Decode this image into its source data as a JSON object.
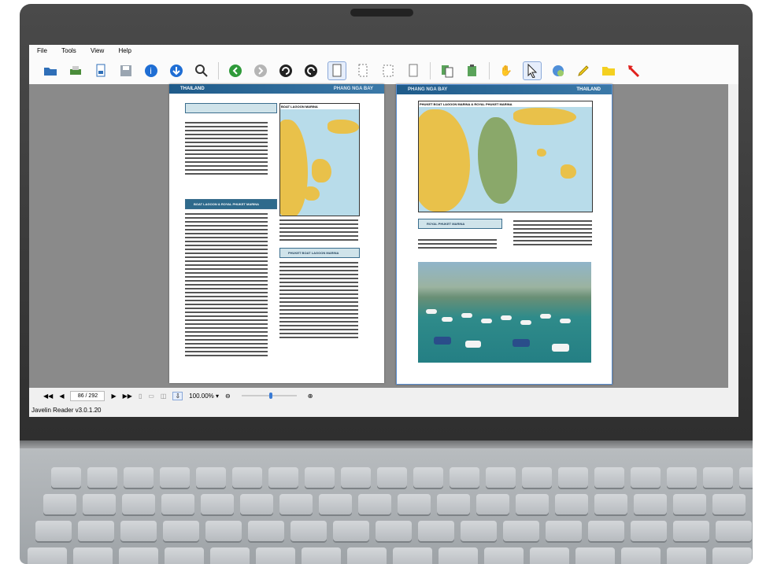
{
  "app": {
    "menu": [
      "File",
      "Tools",
      "View",
      "Help"
    ],
    "status_text": "Javelin Reader v3.0.1.20"
  },
  "toolbar": {
    "icons": [
      "open-folder-icon",
      "print-icon",
      "export-icon",
      "save-icon",
      "info-icon",
      "download-icon",
      "search-icon",
      "back-icon",
      "forward-icon",
      "rotate-left-icon",
      "rotate-right-icon",
      "single-page-icon",
      "continuous-icon",
      "facing-icon",
      "page-icon",
      "copy-icon",
      "paste-icon",
      "hand-tool-icon",
      "select-arrow-icon",
      "zoom-globe-icon",
      "highlighter-icon",
      "folder-note-icon",
      "arrow-tool-icon"
    ]
  },
  "pages": {
    "left_header_left": "THAILAND",
    "left_header_right": "PHANG NGA BAY",
    "right_header_left": "PHANG NGA BAY",
    "right_header_right": "THAILAND",
    "map_title_left": "BOAT LAGOON MARINA",
    "map_title_right": "PHUKET BOAT LAGOON MARINA & ROYAL PHUKET MARINA",
    "section_head": "BOAT LAGOON & ROYAL PHUKET MARINA",
    "box_left": "PHUKET BOAT LAGOON MARINA",
    "box_right": "ROYAL PHUKET MARINA"
  },
  "navigation": {
    "page_indicator": "86 / 292",
    "zoom": "100.00% ▾"
  },
  "colors": {
    "header_blue": "#1f5b8a",
    "doc_bg": "#8a8a8a",
    "accent": "#3a7bd5"
  }
}
